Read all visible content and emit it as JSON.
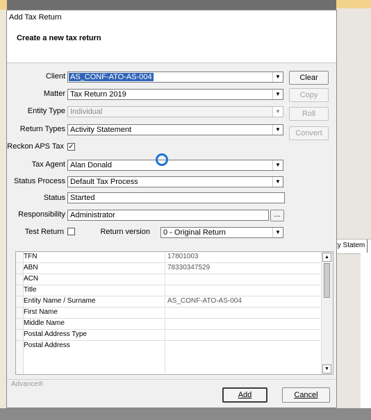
{
  "window": {
    "title": "Add Tax Return"
  },
  "header": {
    "title": "Create a new tax return"
  },
  "form": {
    "client": {
      "label": "Client",
      "value": "AS_CONF-ATO-AS-004"
    },
    "matter": {
      "label": "Matter",
      "value": "Tax Return 2019"
    },
    "entity_type": {
      "label": "Entity Type",
      "value": "Individual"
    },
    "return_types": {
      "label": "Return Types",
      "value": "Activity Statement"
    },
    "reckon_aps_tax": {
      "label": "Reckon APS Tax",
      "checked": "✓"
    },
    "tax_agent": {
      "label": "Tax Agent",
      "value": "Alan Donald"
    },
    "status_process": {
      "label": "Status Process",
      "value": "Default Tax Process"
    },
    "status": {
      "label": "Status",
      "value": "Started"
    },
    "responsibility": {
      "label": "Responsibility",
      "value": "Administrator",
      "browse": "..."
    },
    "test_return": {
      "label": "Test Return"
    },
    "return_version": {
      "label": "Return version",
      "value": "0 - Original Return"
    }
  },
  "side_buttons": {
    "clear": "Clear",
    "copy": "Copy",
    "roll": "Roll",
    "convert": "Convert"
  },
  "grid": {
    "rows": [
      {
        "key": "TFN",
        "value": "17801003"
      },
      {
        "key": "ABN",
        "value": "78330347529"
      },
      {
        "key": "ACN",
        "value": ""
      },
      {
        "key": "Title",
        "value": ""
      },
      {
        "key": "Entity Name / Surname",
        "value": "AS_CONF-ATO-AS-004"
      },
      {
        "key": "First Name",
        "value": ""
      },
      {
        "key": "Middle Name",
        "value": ""
      },
      {
        "key": "Postal Address Type",
        "value": ""
      },
      {
        "key": "Postal Address",
        "value": ""
      }
    ]
  },
  "footer": {
    "brand": "Advance®",
    "add": "Add",
    "cancel": "Cancel"
  },
  "background": {
    "ribbon_text": "tity Statem"
  }
}
